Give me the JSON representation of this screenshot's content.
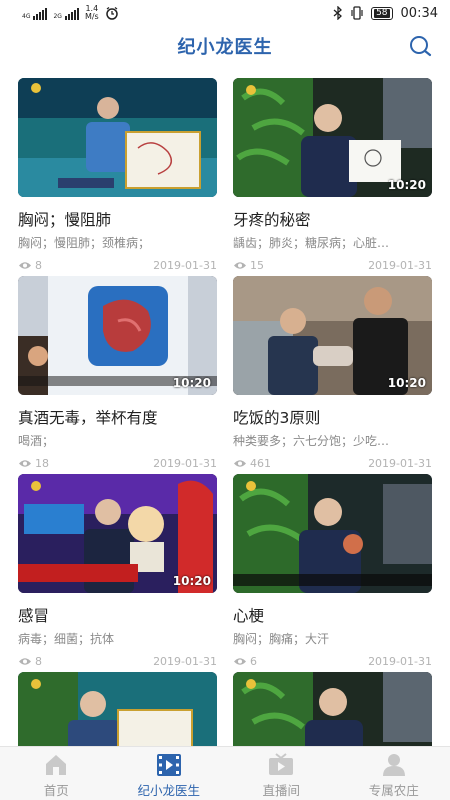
{
  "status_bar": {
    "net1": "4G",
    "net2": "2G",
    "speed_value": "1.4",
    "speed_unit": "M/s",
    "battery": "58",
    "time": "00:34"
  },
  "header": {
    "title": "纪小龙医生"
  },
  "videos": [
    {
      "title": "胸闷；慢阻肺",
      "tags": "胸闷；慢阻肺；颈椎病；",
      "views": "8",
      "date": "2019-01-31",
      "duration": ""
    },
    {
      "title": "牙疼的秘密",
      "tags": "龋齿；肺炎；糖尿病；心脏…",
      "views": "15",
      "date": "2019-01-31",
      "duration": "10:20"
    },
    {
      "title": "真酒无毒，举杯有度",
      "tags": "喝酒；",
      "views": "18",
      "date": "2019-01-31",
      "duration": "10:20"
    },
    {
      "title": "吃饭的3原则",
      "tags": "种类要多；六七分饱；少吃…",
      "views": "461",
      "date": "2019-01-31",
      "duration": "10:20"
    },
    {
      "title": "感冒",
      "tags": "病毒；细菌；抗体",
      "views": "8",
      "date": "2019-01-31",
      "duration": "10:20"
    },
    {
      "title": "心梗",
      "tags": "胸闷；胸痛；大汗",
      "views": "6",
      "date": "2019-01-31",
      "duration": ""
    },
    {
      "title": "",
      "tags": "",
      "views": "",
      "date": "",
      "duration": ""
    },
    {
      "title": "",
      "tags": "",
      "views": "",
      "date": "",
      "duration": ""
    }
  ],
  "nav": {
    "home": "首页",
    "doctor": "纪小龙医生",
    "live": "直播间",
    "farm": "专属农庄"
  },
  "colors": {
    "accent": "#2d64ad",
    "inactive": "#999999"
  }
}
